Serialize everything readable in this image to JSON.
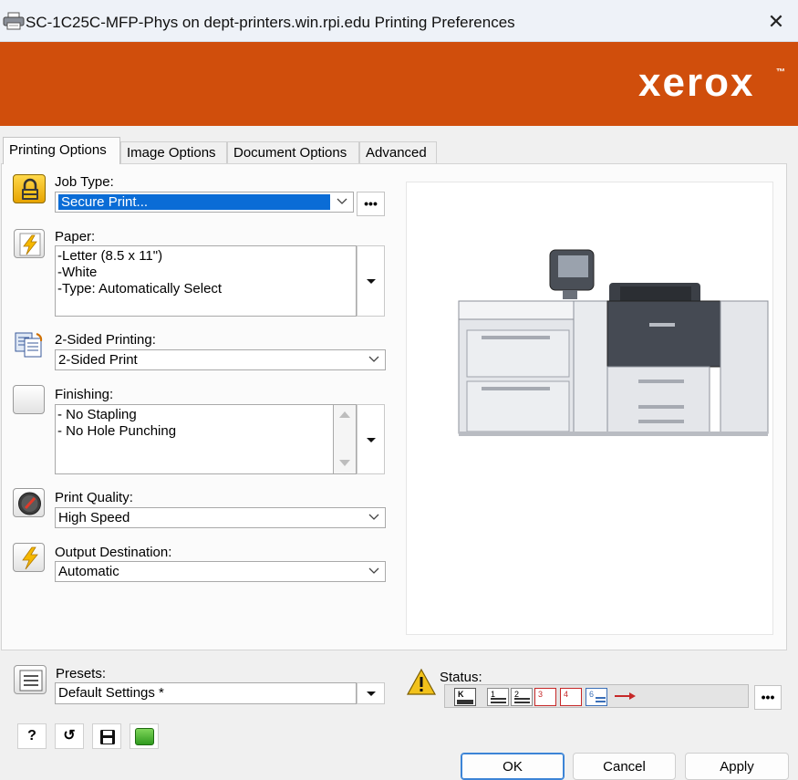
{
  "window": {
    "title": "SC-1C25C-MFP-Phys on dept-printers.win.rpi.edu Printing Preferences",
    "close_glyph": "✕"
  },
  "banner": {
    "brand": "xerox",
    "tm": "™",
    "color": "#d04e0c"
  },
  "tabs": [
    {
      "label": "Printing Options",
      "active": true
    },
    {
      "label": "Image Options",
      "active": false
    },
    {
      "label": "Document Options",
      "active": false
    },
    {
      "label": "Advanced",
      "active": false
    }
  ],
  "job_type": {
    "label": "Job Type:",
    "value": "Secure Print...",
    "more_label": "•••",
    "icon": "lock-icon"
  },
  "paper": {
    "label": "Paper:",
    "lines": [
      "-Letter (8.5 x 11\")",
      "-White",
      "-Type: Automatically Select"
    ],
    "icon": "lightning-icon"
  },
  "two_sided": {
    "label": "2-Sided Printing:",
    "value": "2-Sided Print",
    "icon": "duplex-icon"
  },
  "finishing": {
    "label": "Finishing:",
    "lines": [
      "- No Stapling",
      "- No Hole Punching"
    ],
    "icon": "finishing-icon"
  },
  "print_quality": {
    "label": "Print Quality:",
    "value": "High Speed",
    "icon": "gauge-icon"
  },
  "output_destination": {
    "label": "Output Destination:",
    "value": "Automatic",
    "icon": "lightning-icon"
  },
  "presets": {
    "label": "Presets:",
    "value": "Default Settings *",
    "icon": "presets-list-icon"
  },
  "status": {
    "label": "Status:",
    "icon": "warning-icon",
    "more_label": "•••",
    "trays": [
      "K",
      "1",
      "2",
      "3",
      "4",
      "6"
    ]
  },
  "tools": [
    {
      "name": "help-button",
      "glyph": "?"
    },
    {
      "name": "restore-defaults-button",
      "glyph": "↺"
    },
    {
      "name": "save-button",
      "glyph": "save-icon"
    },
    {
      "name": "eco-button",
      "glyph": "green-leaf-icon"
    }
  ],
  "buttons": {
    "ok": "OK",
    "cancel": "Cancel",
    "apply": "Apply"
  },
  "colors": {
    "accent": "#0a6cd6",
    "warning": "#f2c21b"
  }
}
